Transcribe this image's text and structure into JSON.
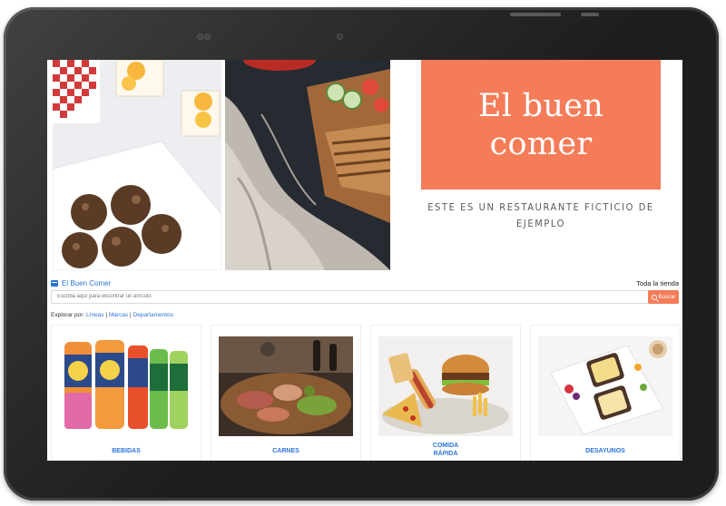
{
  "hero": {
    "brand_title": "El buen comer",
    "tagline": "ESTE ES UN RESTAURANTE FICTICIO DE EJEMPLO",
    "brand_color": "#f47c58"
  },
  "store_bar": {
    "store_name": "El Buen Comer",
    "scope": "Toda la tienda"
  },
  "search": {
    "placeholder": "Escriba aquí para encontrar un artículo",
    "button_label": "Buscar"
  },
  "explore": {
    "prefix": "Explorar por:",
    "links": [
      "Líneas",
      "Marcas",
      "Departamentos"
    ]
  },
  "categories": [
    {
      "label": "BEBIDAS"
    },
    {
      "label": "CARNES"
    },
    {
      "label": "COMIDA RÁPIDA"
    },
    {
      "label": "DESAYUNOS"
    }
  ],
  "colors": {
    "link": "#2a74d8",
    "accent": "#f47c58",
    "device": "#1d1d1d"
  }
}
